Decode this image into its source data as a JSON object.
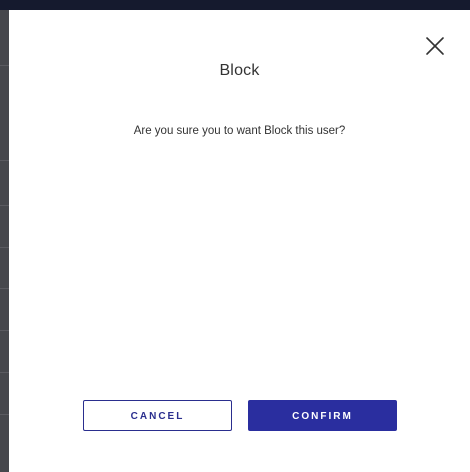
{
  "dialog": {
    "title": "Block",
    "message": "Are you sure you to want Block this user?",
    "close_icon": "close-icon",
    "buttons": {
      "cancel_label": "CANCEL",
      "confirm_label": "CONFIRM"
    }
  },
  "colors": {
    "accent": "#2a2e9f",
    "overlay": "#45454a",
    "top_bar": "#151a2e"
  }
}
